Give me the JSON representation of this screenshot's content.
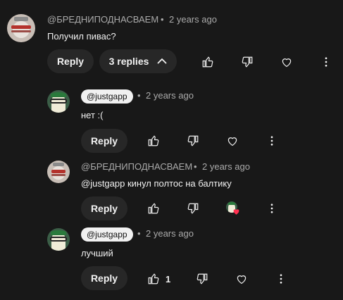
{
  "comment": {
    "author": "@БРЕДНИПОДНАСВАЕМ",
    "time": "2 years ago",
    "text": "Получил пивас?",
    "reply_label": "Reply",
    "replies_label": "3 replies",
    "replies_chevron": "chevron-up-icon"
  },
  "replies": [
    {
      "author": "@justgapp",
      "time": "2 years ago",
      "text": "нет :(",
      "reply_label": "Reply"
    },
    {
      "author": "@БРЕДНИПОДНАСВАЕМ",
      "time": "2 years ago",
      "text": "@justgapp кинул полтос на балтику",
      "reply_label": "Reply",
      "creator_heart": "creator-heart-icon"
    },
    {
      "author": "@justgapp",
      "time": "2 years ago",
      "text": "лучший",
      "reply_label": "Reply",
      "likes": "1"
    }
  ],
  "separator": "•",
  "icons": [
    "like-icon",
    "dislike-icon",
    "heart-icon",
    "more-vert-icon"
  ],
  "colors": {
    "background": "#181818",
    "pill": "#272727",
    "secondary_text": "#aaaaaa",
    "heart_red": "#ff3050"
  }
}
